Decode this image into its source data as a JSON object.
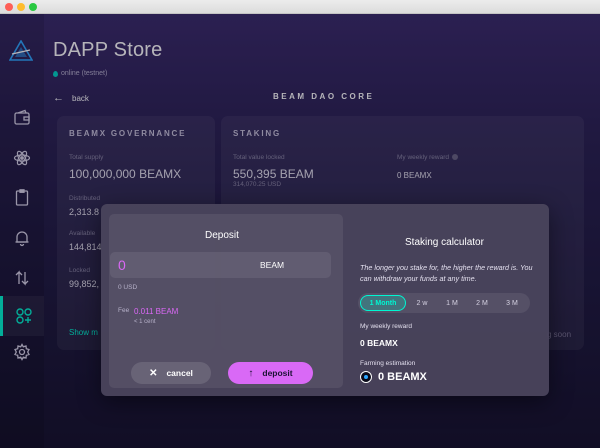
{
  "app": {
    "title": "DAPP Store",
    "status": "online (testnet)"
  },
  "nav": {
    "back_label": "back",
    "section_title": "BEAM DAO CORE"
  },
  "sidebar": {
    "items": [
      {
        "icon": "wallet-icon"
      },
      {
        "icon": "atom-icon"
      },
      {
        "icon": "document-icon"
      },
      {
        "icon": "bell-icon"
      },
      {
        "icon": "transfer-icon"
      },
      {
        "icon": "dapps-icon",
        "active": true
      },
      {
        "icon": "settings-icon"
      }
    ]
  },
  "governance": {
    "title": "BEAMX GOVERNANCE",
    "total_supply_label": "Total supply",
    "total_supply_value": "100,000,000 BEAMX",
    "distributed_label": "Distributed",
    "distributed_value": "2,313.8",
    "available_label": "Available",
    "available_value": "144,814",
    "locked_label": "Locked",
    "locked_value": "99,852,",
    "show_more": "Show m"
  },
  "staking": {
    "title": "STAKING",
    "tvl_label": "Total value locked",
    "tvl_value": "550,395 BEAM",
    "tvl_usd": "314,070.25 USD",
    "weekly_reward_label": "My weekly reward",
    "weekly_reward_value": "0 BEAMX",
    "coming_soon": "g soon"
  },
  "deposit": {
    "title": "Deposit",
    "amount_value": "0",
    "amount_unit": "BEAM",
    "usd_value": "0 USD",
    "fee_label": "Fee",
    "fee_value": "0.011 BEAM",
    "fee_sub": "< 1 cent",
    "cancel_label": "cancel",
    "deposit_label": "deposit"
  },
  "calculator": {
    "title": "Staking calculator",
    "description": "The longer you stake for, the higher the reward is. You can withdraw your funds at any time.",
    "periods": [
      "1 Month",
      "2 w",
      "1 M",
      "2 M",
      "3 M"
    ],
    "selected_period": "1 Month",
    "weekly_reward_label": "My weekly reward",
    "weekly_reward_value": "0 BEAMX",
    "farming_label": "Farming estimation",
    "farming_value": "0 BEAMX"
  },
  "colors": {
    "accent_teal": "#00f6d2",
    "accent_pink": "#d969f6",
    "background_top": "#3a2b6b",
    "background_bottom": "#15122c"
  }
}
